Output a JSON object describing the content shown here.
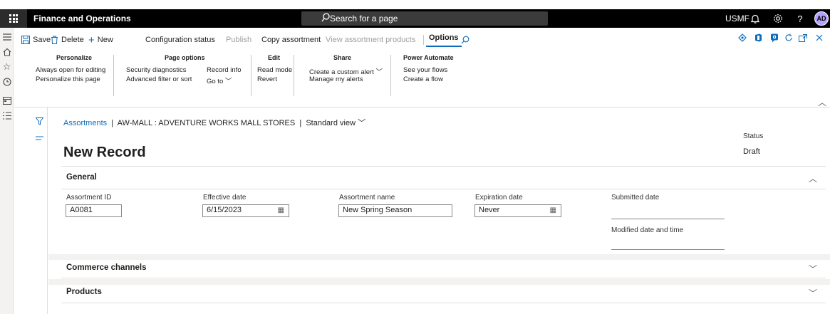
{
  "topbar": {
    "app_title": "Finance and Operations",
    "search_placeholder": "Search for a page",
    "company": "USMF",
    "avatar_initials": "AD"
  },
  "rail_icons": [
    "hamburger-icon",
    "home-icon",
    "star-icon",
    "clock-icon",
    "workspace-icon",
    "list-icon"
  ],
  "toolbar": {
    "save": "Save",
    "delete": "Delete",
    "new": "New",
    "configuration_status": "Configuration status",
    "publish": "Publish",
    "copy_assortment": "Copy assortment",
    "view_assortment_products": "View assortment products",
    "options": "Options"
  },
  "ribbon": {
    "personalize": {
      "header": "Personalize",
      "items": [
        "Always open for editing",
        "Personalize this page"
      ]
    },
    "page_options": {
      "header": "Page options",
      "items": [
        "Security diagnostics",
        "Advanced filter or sort",
        "Record info",
        "Go to"
      ]
    },
    "edit": {
      "header": "Edit",
      "items": [
        "Read mode",
        "Revert"
      ]
    },
    "share": {
      "header": "Share",
      "items": [
        "Create a custom alert",
        "Manage my alerts"
      ]
    },
    "power_automate": {
      "header": "Power Automate",
      "items": [
        "See your flows",
        "Create a flow"
      ]
    }
  },
  "breadcrumb": {
    "root": "Assortments",
    "record": "AW-MALL : ADVENTURE WORKS MALL STORES",
    "view": "Standard view"
  },
  "page": {
    "title": "New Record",
    "status_label": "Status",
    "status_value": "Draft"
  },
  "general": {
    "header": "General",
    "assortment_id_label": "Assortment ID",
    "assortment_id_value": "A0081",
    "effective_date_label": "Effective date",
    "effective_date_value": "6/15/2023",
    "assortment_name_label": "Assortment name",
    "assortment_name_value": "New Spring Season",
    "expiration_date_label": "Expiration date",
    "expiration_date_value": "Never",
    "submitted_date_label": "Submitted date",
    "modified_label": "Modified date and time"
  },
  "sections": {
    "commerce_channels": "Commerce channels",
    "products": "Products"
  },
  "colors": {
    "accent": "#0f6cbd",
    "topbar": "#000000"
  }
}
